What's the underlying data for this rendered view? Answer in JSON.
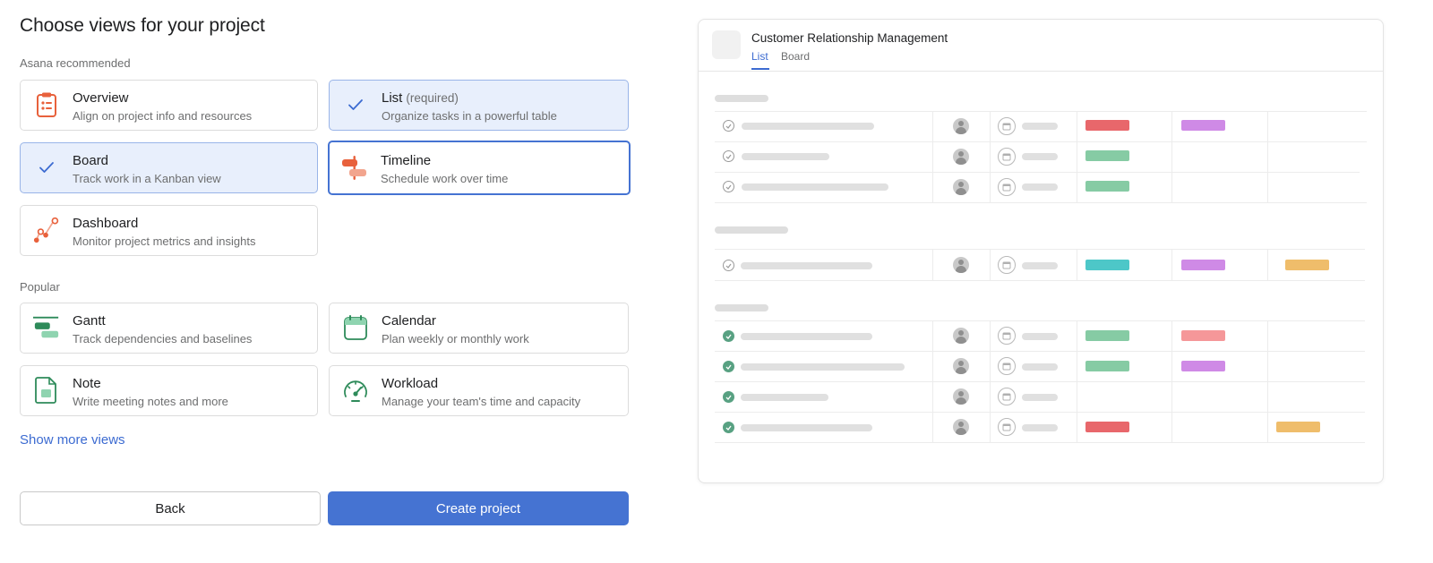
{
  "page": {
    "title": "Choose views for your project",
    "section_recommended": "Asana recommended",
    "section_popular": "Popular",
    "show_more": "Show more views"
  },
  "views": {
    "overview": {
      "title": "Overview",
      "desc": "Align on project info and resources",
      "icon": "clipboard-icon",
      "color": "#e8613c",
      "selected": false
    },
    "list": {
      "title": "List",
      "suffix": "(required)",
      "desc": "Organize tasks in a powerful table",
      "icon": "check-icon",
      "selected": true
    },
    "board": {
      "title": "Board",
      "desc": "Track work in a Kanban view",
      "icon": "check-icon",
      "selected": true
    },
    "timeline": {
      "title": "Timeline",
      "desc": "Schedule work over time",
      "icon": "timeline-icon",
      "color": "#e8613c",
      "selected": false
    },
    "dashboard": {
      "title": "Dashboard",
      "desc": "Monitor project metrics and insights",
      "icon": "dashboard-chart-icon",
      "color": "#e8613c",
      "selected": false
    },
    "gantt": {
      "title": "Gantt",
      "desc": "Track dependencies and baselines",
      "icon": "gantt-icon",
      "color": "#2e8b5a",
      "selected": false
    },
    "calendar": {
      "title": "Calendar",
      "desc": "Plan weekly or monthly work",
      "icon": "calendar-icon",
      "color": "#2e8b5a",
      "selected": false
    },
    "note": {
      "title": "Note",
      "desc": "Write meeting notes and more",
      "icon": "note-icon",
      "color": "#2e8b5a",
      "selected": false
    },
    "workload": {
      "title": "Workload",
      "desc": "Manage your team's time and capacity",
      "icon": "gauge-icon",
      "color": "#2e8b5a",
      "selected": false
    }
  },
  "buttons": {
    "back": "Back",
    "create": "Create project"
  },
  "preview": {
    "project_name": "Customer Relationship Management",
    "tabs": [
      "List",
      "Board"
    ],
    "active_tab": "List",
    "colors": {
      "red": "#e8676b",
      "purple": "#cf8ae6",
      "green": "#86cba4",
      "teal": "#4dc7c8",
      "orange": "#efbd6b",
      "pink": "#f59799",
      "done": "#58a182",
      "accent": "#4573d2"
    }
  }
}
